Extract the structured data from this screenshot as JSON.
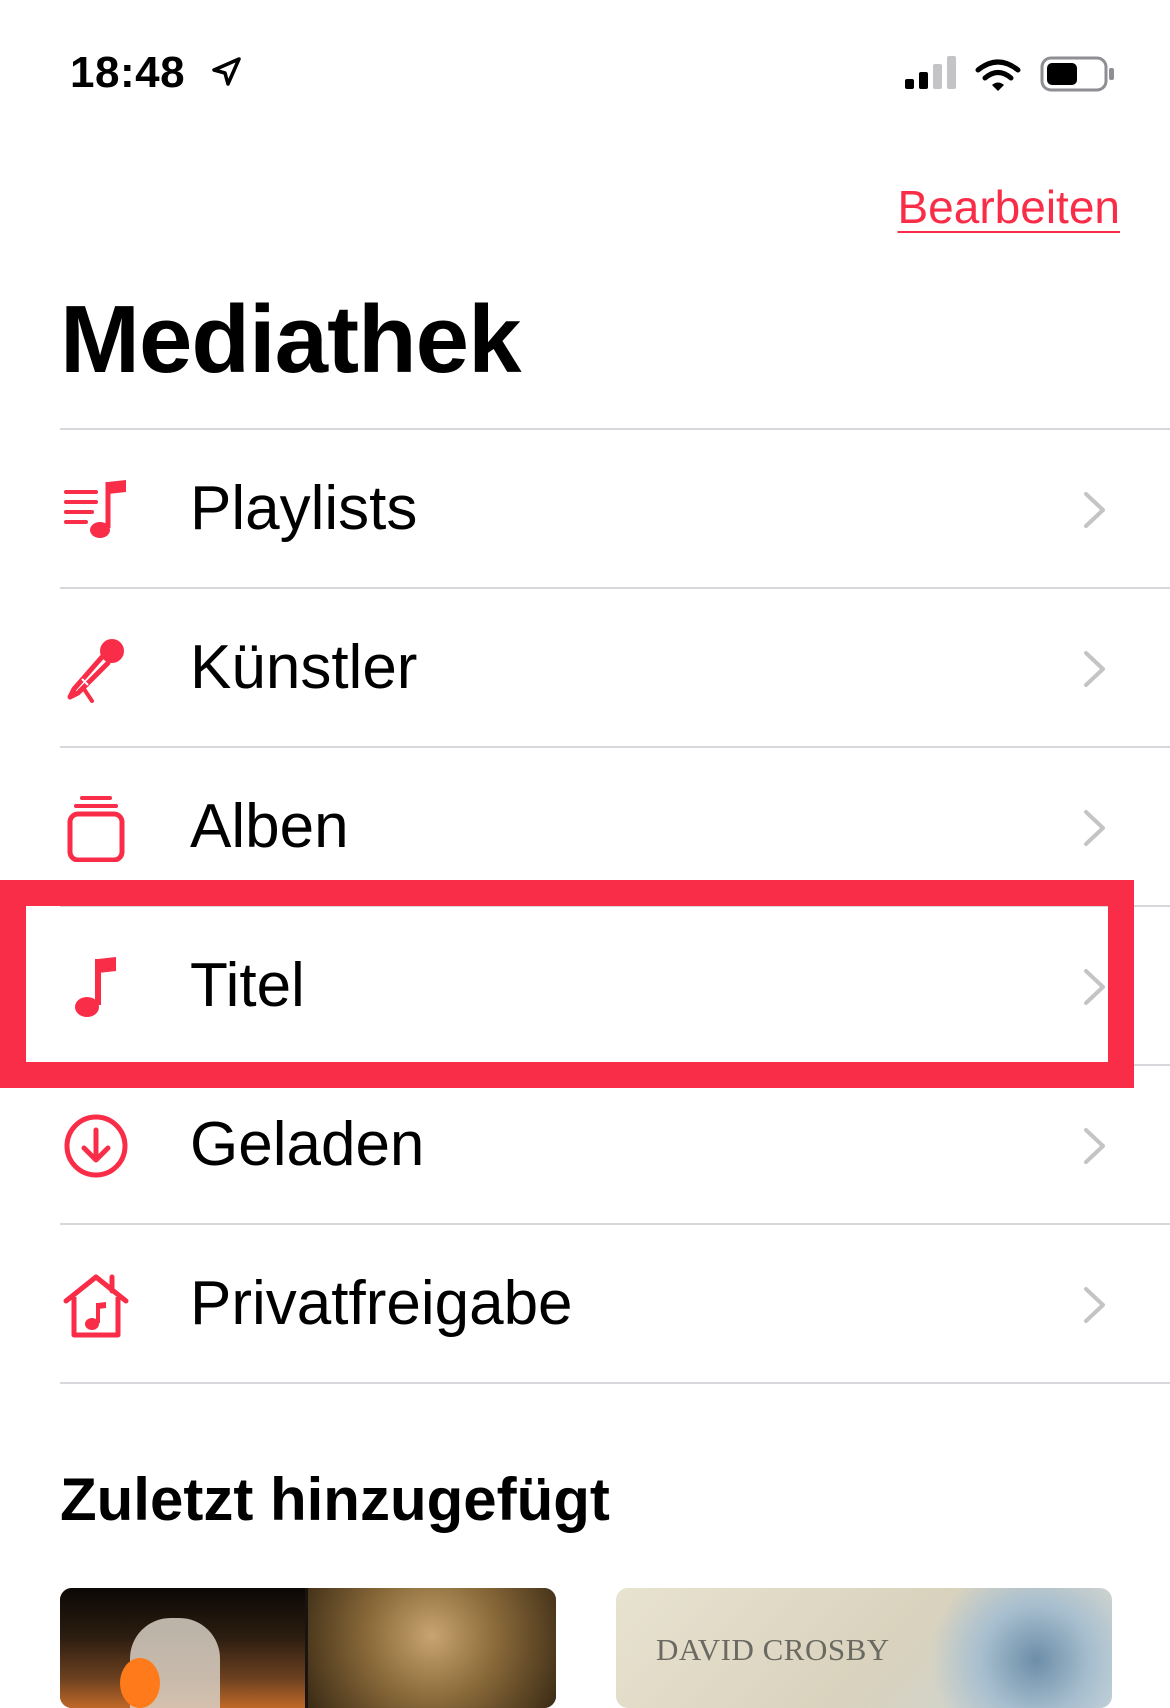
{
  "status_bar": {
    "time": "18:48"
  },
  "header": {
    "edit_label": "Bearbeiten",
    "title": "Mediathek"
  },
  "menu": {
    "items": [
      {
        "label": "Playlists",
        "icon": "playlist-icon"
      },
      {
        "label": "Künstler",
        "icon": "microphone-icon"
      },
      {
        "label": "Alben",
        "icon": "album-stack-icon"
      },
      {
        "label": "Titel",
        "icon": "music-note-icon",
        "highlighted": true
      },
      {
        "label": "Geladen",
        "icon": "download-circle-icon"
      },
      {
        "label": "Privatfreigabe",
        "icon": "home-music-icon"
      }
    ]
  },
  "recently_added": {
    "title": "Zuletzt hinzugefügt",
    "albums": [
      {
        "art_text": ""
      },
      {
        "art_text": "DAVID CROSBY"
      }
    ]
  },
  "colors": {
    "accent": "#fa2d48",
    "divider": "#d8d8dc",
    "chevron": "#c4c4c7"
  }
}
